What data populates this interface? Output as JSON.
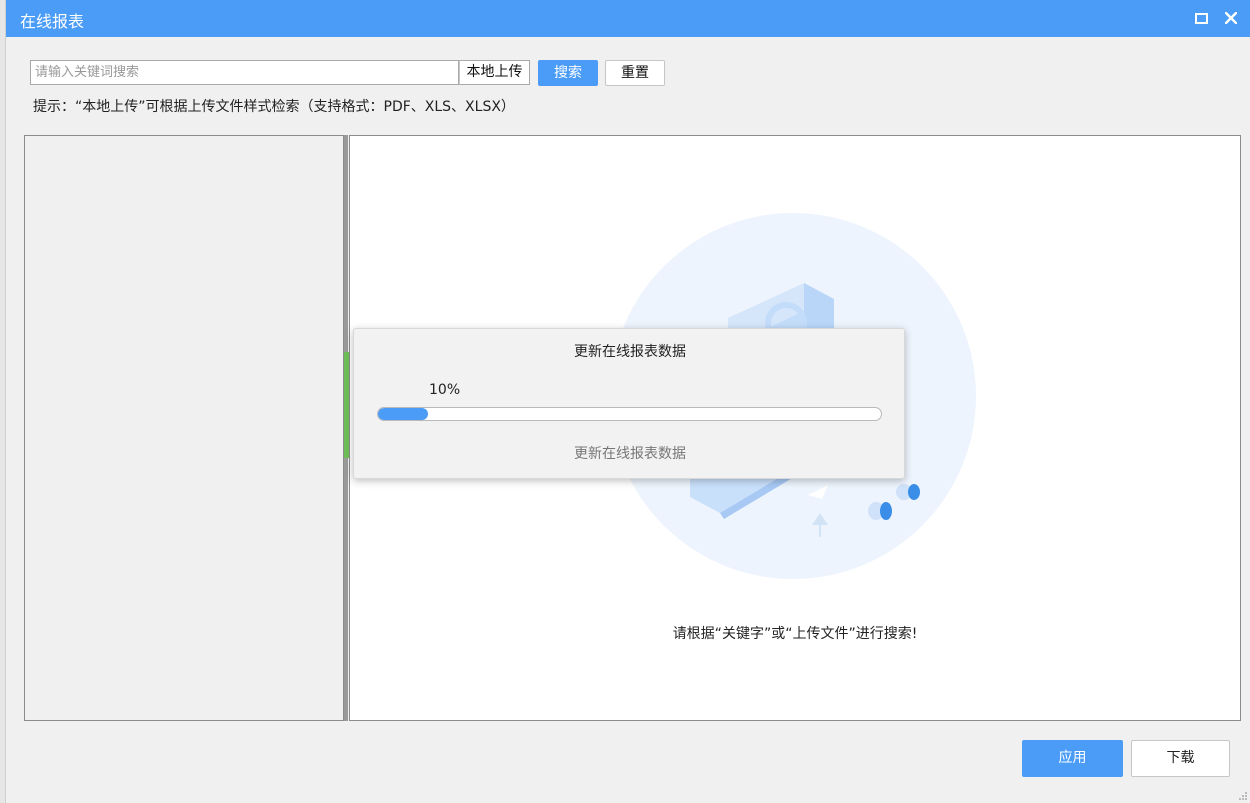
{
  "window": {
    "title": "在线报表"
  },
  "search": {
    "placeholder": "请输入关键词搜索",
    "value": "",
    "upload_label": "本地上传",
    "search_label": "搜索",
    "reset_label": "重置",
    "hint": "提示：“本地上传”可根据上传文件样式检索（支持格式：PDF、XLS、XLSX）"
  },
  "result": {
    "empty_message": "请根据“关键字”或“上传文件”进行搜索!"
  },
  "progress": {
    "title": "更新在线报表数据",
    "percent_label": "10%",
    "value": 0.1,
    "status": "更新在线报表数据"
  },
  "footer": {
    "apply_label": "应用",
    "download_label": "下载"
  },
  "colors": {
    "accent": "#4a9cf7",
    "splitter_handle": "#6fbf58"
  },
  "icons": [
    "maximize-icon",
    "close-icon",
    "empty-search-illustration",
    "resize-grip-icon"
  ]
}
